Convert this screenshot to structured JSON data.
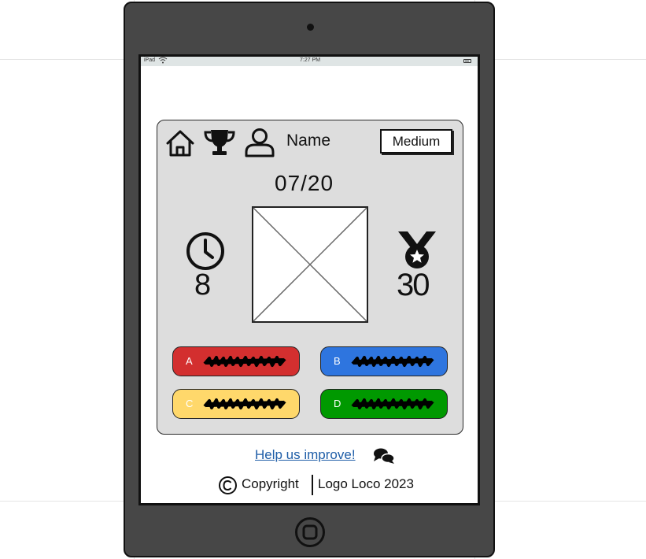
{
  "device": {
    "status_bar": {
      "carrier": "iPad",
      "time": "7:27 PM"
    }
  },
  "header": {
    "icons": [
      "home-icon",
      "trophy-icon",
      "user-icon"
    ],
    "name_label": "Name",
    "difficulty_label": "Medium"
  },
  "game": {
    "progress": "07/20",
    "timer_icon": "clock-icon",
    "timer_value": "8",
    "score_icon": "medal-icon",
    "score_value": "30",
    "image_placeholder": "image-placeholder"
  },
  "answers": [
    {
      "letter": "A",
      "color": "#d32f2f"
    },
    {
      "letter": "B",
      "color": "#2e75df"
    },
    {
      "letter": "C",
      "color": "#ffd86b"
    },
    {
      "letter": "D",
      "color": "#009900"
    }
  ],
  "footer": {
    "help_link": "Help us improve!",
    "feedback_icon": "chat-bubbles-icon",
    "copyright_text": "Copyright",
    "brand_text": "Logo Loco 2023"
  }
}
